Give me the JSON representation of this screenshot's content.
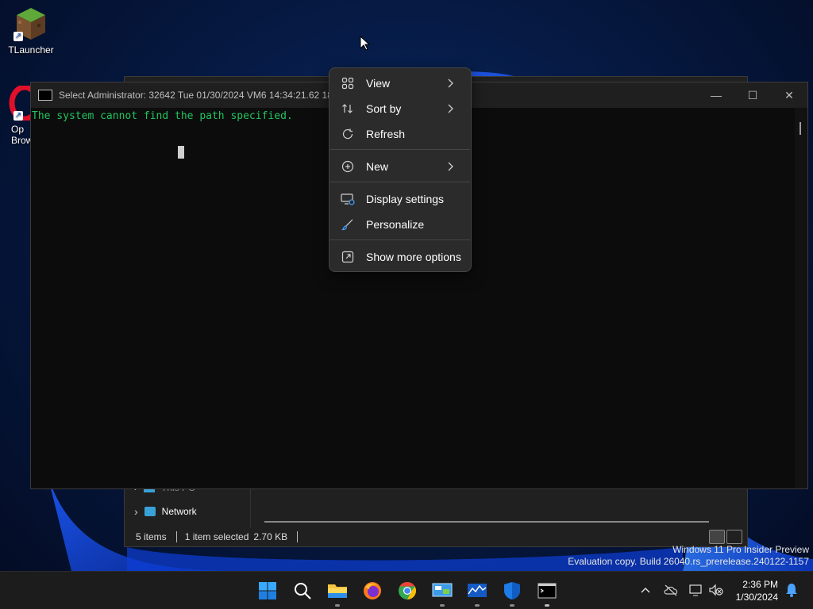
{
  "desktop": {
    "icons": [
      {
        "label": "TLauncher",
        "icon": "tlauncher-icon"
      },
      {
        "label": "Op\nBrow",
        "icon": "opera-browser-icon"
      }
    ]
  },
  "explorer": {
    "nav_partial": "This PC",
    "nav_network": "Network",
    "status": {
      "items": "5 items",
      "selected": "1 item selected",
      "size": "2.70 KB"
    }
  },
  "cmd": {
    "title": "Select Administrator:  32642 Tue 01/30/2024 VM6 14:34:21.62 18",
    "output_line": "The system cannot find the path specified.",
    "controls": {
      "minimize": "—",
      "maximize": "☐",
      "close": "✕"
    }
  },
  "context_menu": {
    "items": [
      {
        "label": "View",
        "icon": "view-grid-icon",
        "submenu": true
      },
      {
        "label": "Sort by",
        "icon": "sort-arrows-icon",
        "submenu": true
      },
      {
        "label": "Refresh",
        "icon": "refresh-icon",
        "submenu": false
      },
      {
        "label": "New",
        "icon": "new-plus-icon",
        "submenu": true
      },
      {
        "label": "Display settings",
        "icon": "display-settings-icon",
        "submenu": false
      },
      {
        "label": "Personalize",
        "icon": "personalize-brush-icon",
        "submenu": false
      },
      {
        "label": "Show more options",
        "icon": "show-more-options-icon",
        "submenu": false
      }
    ]
  },
  "watermark": {
    "line1": "Windows 11 Pro Insider Preview",
    "line2": "Evaluation copy. Build 26040.rs_prerelease.240122-1157"
  },
  "taskbar": {
    "apps": [
      "start-icon",
      "search-icon",
      "file-explorer-icon",
      "firefox-icon",
      "chrome-icon",
      "control-panel-icon",
      "resource-monitor-icon",
      "defender-shield-icon",
      "cmd-icon"
    ],
    "clock": {
      "time": "2:36 PM",
      "date": "1/30/2024"
    }
  },
  "colors": {
    "cmd_text": "#22c55e",
    "menu_bg": "#2b2b2b",
    "taskbar_bg": "#1c1c1c"
  }
}
